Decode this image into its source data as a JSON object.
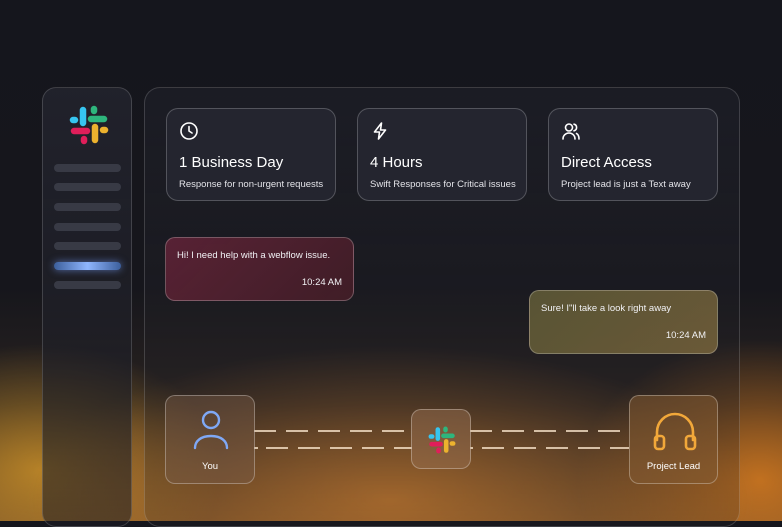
{
  "sidebar": {
    "logo_icon": "slack-logo-icon",
    "nav_items": [
      {
        "active": false
      },
      {
        "active": false
      },
      {
        "active": false
      },
      {
        "active": false
      },
      {
        "active": false
      },
      {
        "active": true
      },
      {
        "active": false
      }
    ]
  },
  "cards": [
    {
      "icon": "clock-icon",
      "title": "1 Business Day",
      "subtitle": "Response for non-urgent requests"
    },
    {
      "icon": "lightning-icon",
      "title": "4 Hours",
      "subtitle": "Swift Responses for Critical issues"
    },
    {
      "icon": "users-icon",
      "title": "Direct Access",
      "subtitle": "Project lead is just a Text away"
    }
  ],
  "chat": {
    "user_message": {
      "text": "Hi! I need help with a webflow issue.",
      "time": "10:24 AM"
    },
    "lead_message": {
      "text": "Sure! I\"ll take a look right away",
      "time": "10:24 AM"
    }
  },
  "connection": {
    "you": {
      "icon": "user-icon",
      "label": "You"
    },
    "hub": {
      "icon": "slack-logo-icon"
    },
    "lead": {
      "icon": "headphones-icon",
      "label": "Project Lead"
    }
  },
  "colors": {
    "accent_blue": "#8fb6ff",
    "accent_orange": "#e89a2c",
    "user_bubble": "#5f2337",
    "lead_bubble": "#6e6a40"
  }
}
